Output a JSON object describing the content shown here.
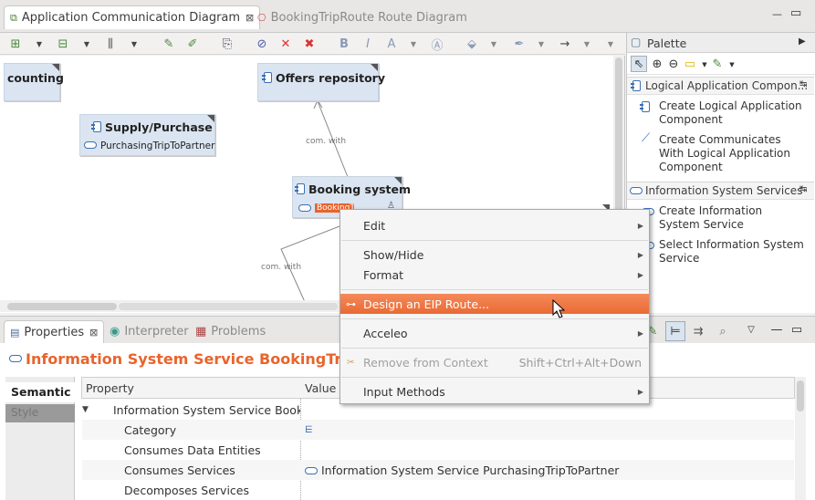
{
  "editor_tabs": [
    {
      "label": "Application Communication Diagram",
      "close": "⊠"
    },
    {
      "label": "BookingTripRoute Route Diagram"
    }
  ],
  "window_controls": {
    "minimize": "—",
    "maximize": "▭"
  },
  "diagram": {
    "nodes": {
      "accounting": "counting",
      "offers": "Offers repository",
      "supply": "Supply/Purchase",
      "supply_service": "PurchasingTripToPartner",
      "booking": "Booking system",
      "booking_service": "BookingTrip"
    },
    "edge_labels": [
      "com. with",
      "com. with"
    ]
  },
  "palette": {
    "title": "Palette",
    "drawers": [
      {
        "label": "Logical Application Compon...",
        "items": [
          "Create Logical Application Component",
          "Create Communicates With Logical Application Component"
        ]
      },
      {
        "label": "Information System Services",
        "items": [
          "Create Information System Service",
          "Select Information System Service"
        ]
      }
    ]
  },
  "context_menu": {
    "items": [
      {
        "label": "Edit",
        "submenu": true
      },
      {
        "label": "Show/Hide",
        "submenu": true
      },
      {
        "label": "Format",
        "submenu": true
      },
      {
        "label": "Design an EIP Route...",
        "highlighted": true
      },
      {
        "label": "Acceleo",
        "submenu": true
      },
      {
        "label": "Remove from Context",
        "shortcut": "Shift+Ctrl+Alt+Down",
        "disabled": true
      },
      {
        "label": "Input Methods",
        "submenu": true
      }
    ]
  },
  "bottom_tabs": [
    {
      "label": "Properties",
      "close": "⊠"
    },
    {
      "label": "Interpreter"
    },
    {
      "label": "Problems"
    }
  ],
  "properties": {
    "title": "Information System Service BookingTrip",
    "side_tabs": [
      "Semantic",
      "Style"
    ],
    "columns": [
      "Property",
      "Value"
    ],
    "rows": [
      {
        "property": "Information System Service BookingTrip",
        "value": ""
      },
      {
        "property": "Category",
        "value": ""
      },
      {
        "property": "Consumes Data Entities",
        "value": ""
      },
      {
        "property": "Consumes Services",
        "value": "Information System Service PurchasingTripToPartner"
      },
      {
        "property": "Decomposes Services",
        "value": ""
      }
    ]
  },
  "colors": {
    "accent": "#e8642c",
    "menu_highlight": "#f07746",
    "node_fill": "#dbe5f1"
  }
}
